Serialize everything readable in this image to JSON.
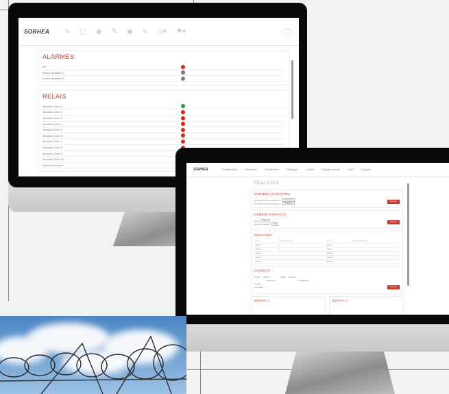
{
  "monitor1": {
    "logo": "SORHEA",
    "toolbar_icons": [
      "edit-icon",
      "copy-icon",
      "eye-icon",
      "edit-icon",
      "network-icon",
      "edit-icon",
      "clock-dropdown-icon",
      "flag-dropdown-icon"
    ],
    "alarmes": {
      "title": "ALARMES",
      "rows": [
        {
          "label": "AP",
          "status": "red"
        },
        {
          "label": "Entrée auxiliaire 1",
          "status": "grey"
        },
        {
          "label": "Entrée auxiliaire 2",
          "status": "grey"
        }
      ]
    },
    "relais": {
      "title": "RELAIS",
      "rows": [
        {
          "label": "Intrusion Zone 1",
          "status": "green"
        },
        {
          "label": "Intrusion Zone 2",
          "status": "red"
        },
        {
          "label": "Intrusion Zone 3",
          "status": "red"
        },
        {
          "label": "Intrusion Zone 4",
          "status": "red"
        },
        {
          "label": "Intrusion Zone 5",
          "status": "red"
        },
        {
          "label": "Intrusion Zone 6",
          "status": "red"
        },
        {
          "label": "Intrusion Zone 7",
          "status": "red"
        },
        {
          "label": "Intrusion Zone 8",
          "status": "red"
        },
        {
          "label": "Intrusion Zone 9",
          "status": "red"
        },
        {
          "label": "Intrusion Zone 10",
          "status": "red"
        },
        {
          "label": "Défaut technique",
          "status": "green"
        }
      ]
    }
  },
  "monitor2": {
    "logo": "SORHEA",
    "nav": [
      "Configuration",
      "Historique",
      "Visualisation",
      "Réglages",
      "Qualité",
      "Réglage avancé",
      "Aide",
      "Langues"
    ],
    "page_title": "RÉGLAGES",
    "panels": {
      "entrees": {
        "title": "ENTRÉES AUXILIAIRES",
        "lines": [
          "Sécurité de l'entrée auxiliaire 1",
          "Sécurité de l'entrée auxiliaire 2"
        ],
        "select": "Désactivé",
        "button": "Envoyer"
      },
      "nombre": {
        "title": "NOMBRE D'IMPACTS",
        "lines": [
          "Zone",
          "Nombre d'impacts"
        ],
        "select": "Zone 1",
        "value": "10",
        "button": "Envoyer"
      },
      "reglages": {
        "title": "RÉGLAGES",
        "headers": [
          "Zone",
          "Nombre d'impacts",
          "Zone",
          "Nombre d'impacts"
        ],
        "rows": [
          [
            "Zone 1",
            "1",
            "Zone 6",
            ""
          ],
          [
            "Zone 2",
            "1",
            "Zone 7",
            ""
          ],
          [
            "Zone 3",
            "",
            "Zone 8",
            ""
          ],
          [
            "Zone 4",
            "",
            "Zone 9",
            ""
          ],
          [
            "Zone 5",
            "",
            "Zone 10",
            ""
          ]
        ]
      },
      "stabilite": {
        "title": "STABILITÉ",
        "lines": [
          "Temps :",
          "Mode :",
          "Lecture :",
          "Sensibilité :"
        ],
        "options": [
          "Temps 1",
          "Désactivé",
          "Sélection",
          "Configuration"
        ],
        "button": "Envoyer"
      },
      "depart1": {
        "title": "DÉPART 1"
      },
      "depart2": {
        "title": "DÉPART 2"
      }
    }
  },
  "colors": {
    "accent": "#d9342b",
    "green": "#1e9a3a",
    "grey": "#7d7d7d",
    "red": "#e0231a"
  }
}
